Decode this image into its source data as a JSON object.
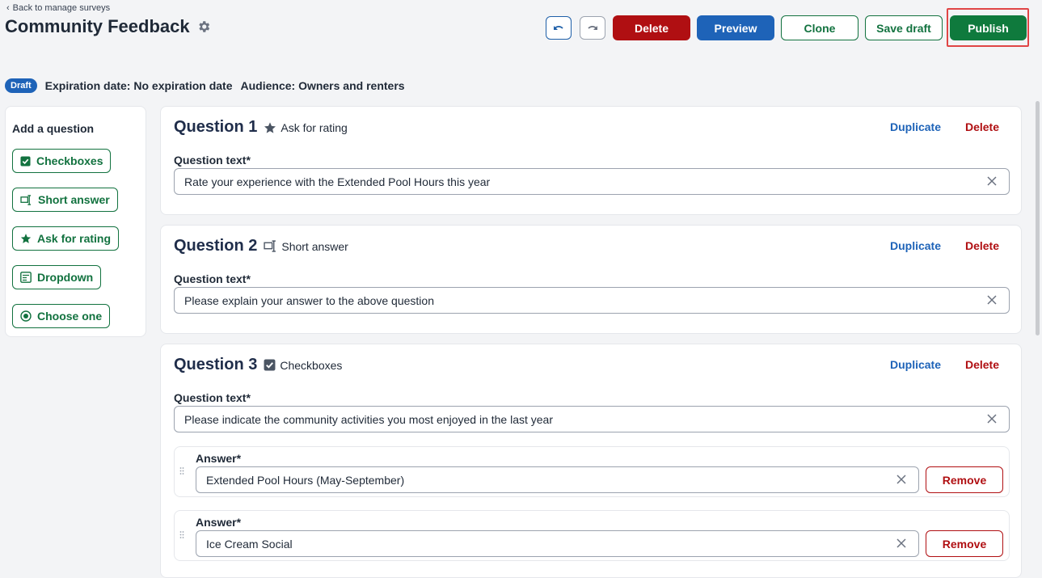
{
  "header": {
    "back_label": "Back to manage surveys",
    "title": "Community Feedback",
    "buttons": {
      "delete": "Delete",
      "preview": "Preview",
      "clone": "Clone",
      "save_draft": "Save draft",
      "publish": "Publish"
    }
  },
  "meta": {
    "status_badge": "Draft",
    "expiration": "Expiration date: No expiration date",
    "audience": "Audience: Owners and renters"
  },
  "add_panel": {
    "title": "Add a question",
    "items": [
      {
        "label": "Checkboxes",
        "icon": "checkbox-icon"
      },
      {
        "label": "Short answer",
        "icon": "short-answer-icon"
      },
      {
        "label": "Ask for rating",
        "icon": "star-icon"
      },
      {
        "label": "Dropdown",
        "icon": "dropdown-icon"
      },
      {
        "label": "Choose one",
        "icon": "radio-icon"
      }
    ]
  },
  "questions": [
    {
      "title": "Question 1",
      "type_label": "Ask for rating",
      "type_icon": "star-icon",
      "duplicate": "Duplicate",
      "delete": "Delete",
      "text_label": "Question text*",
      "text_value": "Rate your experience with the Extended Pool Hours this year"
    },
    {
      "title": "Question 2",
      "type_label": "Short answer",
      "type_icon": "short-answer-icon",
      "duplicate": "Duplicate",
      "delete": "Delete",
      "text_label": "Question text*",
      "text_value": "Please explain your answer to the above question"
    },
    {
      "title": "Question 3",
      "type_label": "Checkboxes",
      "type_icon": "checkbox-icon",
      "duplicate": "Duplicate",
      "delete": "Delete",
      "text_label": "Question text*",
      "text_value": "Please indicate the community activities you most enjoyed in the last year",
      "answers": [
        {
          "label": "Answer*",
          "value": "Extended Pool Hours (May-September)",
          "remove": "Remove"
        },
        {
          "label": "Answer*",
          "value": "Ice Cream Social",
          "remove": "Remove"
        }
      ]
    }
  ],
  "colors": {
    "primary_blue": "#1e63b8",
    "danger_red": "#b00f12",
    "success_green": "#0f7a3d",
    "highlight": "#e04545"
  }
}
